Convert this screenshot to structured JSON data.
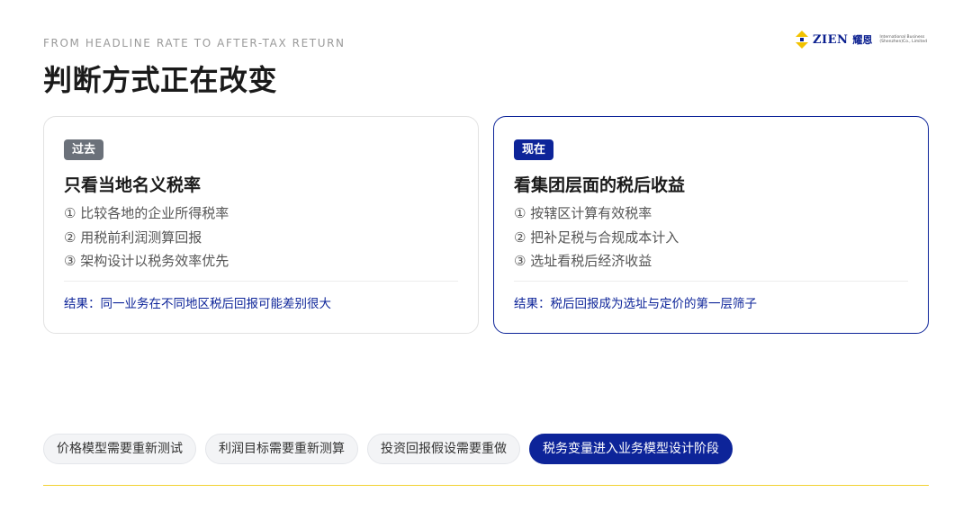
{
  "header": {
    "eyebrow": "FROM HEADLINE RATE TO AFTER-TAX RETURN",
    "title": "判断方式正在改变"
  },
  "logo": {
    "wordmark": "ZIEN",
    "chinese": "耀恩",
    "sub_line1": "International Business",
    "sub_line2": "(Shenzhen)Co., Limited",
    "brand_color": "#0a1f8f",
    "accent_color": "#f2c200"
  },
  "cards": [
    {
      "tag": "过去",
      "heading": "只看当地名义税率",
      "items": [
        "① 比较各地的企业所得税率",
        "② 用税前利润测算回报",
        "③ 架构设计以税务效率优先"
      ],
      "result": "结果：同一业务在不同地区税后回报可能差别很大"
    },
    {
      "tag": "现在",
      "heading": "看集团层面的税后收益",
      "items": [
        "① 按辖区计算有效税率",
        "② 把补足税与合规成本计入",
        "③ 选址看税后经济收益"
      ],
      "result": "结果：税后回报成为选址与定价的第一层筛子"
    }
  ],
  "chips": [
    "价格模型需要重新测试",
    "利润目标需要重新测算",
    "投资回报假设需要重做",
    "税务变量进入业务模型设计阶段"
  ],
  "colors": {
    "primary": "#0d2499",
    "past_tag": "#6b717a",
    "rule": "#f2d233"
  }
}
